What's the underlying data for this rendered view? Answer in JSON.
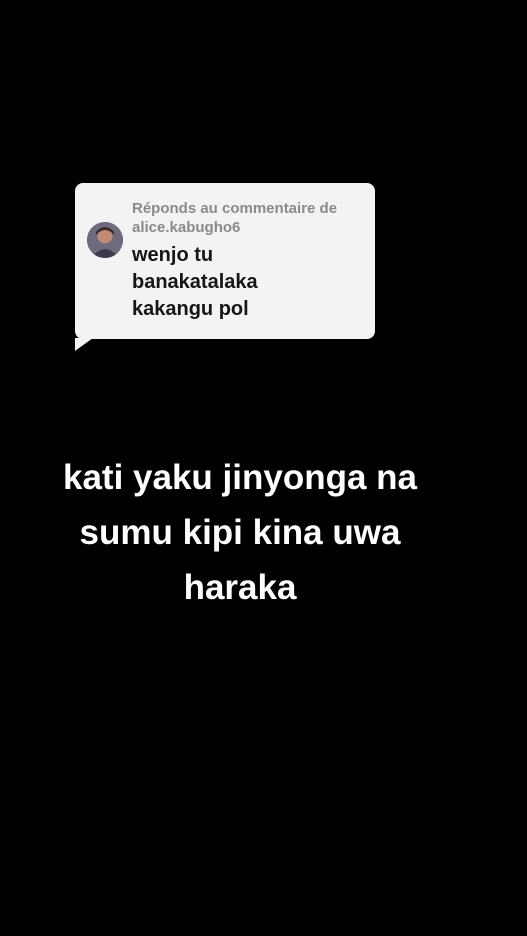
{
  "reply_card": {
    "header_line1": "Réponds au commentaire de",
    "header_line2": "alice.kabugho6",
    "comment_lines": [
      "wenjo tu",
      "banakatalaka",
      "kakangu pol"
    ],
    "bg_color": "#f3f3f3"
  },
  "caption": {
    "lines": [
      "kati yaku jinyonga na",
      "sumu kipi kina uwa",
      "haraka"
    ],
    "color": "#ffffff"
  },
  "background_color": "#000000"
}
